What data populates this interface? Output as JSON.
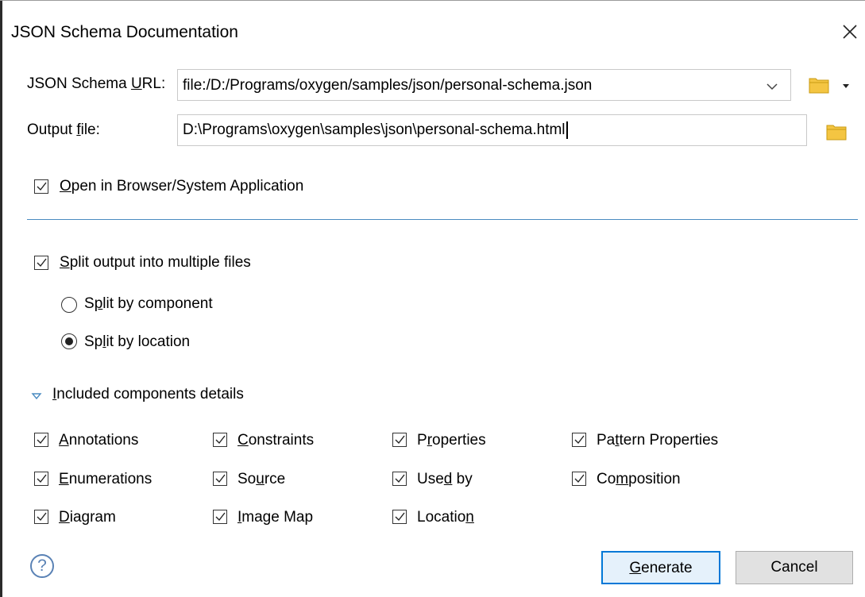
{
  "dialog": {
    "title": "JSON Schema Documentation"
  },
  "schema_url": {
    "label_pre": "JSON Schema ",
    "label_mn": "U",
    "label_post": "RL:",
    "value": "file:/D:/Programs/oxygen/samples/json/personal-schema.json"
  },
  "output_file": {
    "label_pre": "Output ",
    "label_mn": "f",
    "label_post": "ile:",
    "value": "D:\\Programs\\oxygen\\samples\\json\\personal-schema.html"
  },
  "open_browser": {
    "mn": "O",
    "rest": "pen in Browser/System Application",
    "checked": true
  },
  "split_output": {
    "mn": "S",
    "rest": "plit output into multiple files",
    "checked": true
  },
  "split_component": {
    "pre": "S",
    "mn": "p",
    "post": "lit by component",
    "selected": false
  },
  "split_location": {
    "pre": "Sp",
    "mn": "l",
    "post": "it by location",
    "selected": true
  },
  "included": {
    "mn": "I",
    "rest": "ncluded components details",
    "expanded": true
  },
  "components": {
    "annotations": {
      "pre": "",
      "mn": "A",
      "post": "nnotations",
      "checked": true
    },
    "constraints": {
      "pre": "",
      "mn": "C",
      "post": "onstraints",
      "checked": true
    },
    "properties": {
      "pre": "P",
      "mn": "r",
      "post": "operties",
      "checked": true
    },
    "pattern_properties": {
      "pre": "Pa",
      "mn": "t",
      "post": "tern Properties",
      "checked": true
    },
    "enumerations": {
      "pre": "",
      "mn": "E",
      "post": "numerations",
      "checked": true
    },
    "source": {
      "pre": "So",
      "mn": "u",
      "post": "rce",
      "checked": true
    },
    "used_by": {
      "pre": "Use",
      "mn": "d",
      "post": " by",
      "checked": true
    },
    "composition": {
      "pre": "Co",
      "mn": "m",
      "post": "position",
      "checked": true
    },
    "diagram": {
      "pre": "",
      "mn": "D",
      "post": "iagram",
      "checked": true
    },
    "image_map": {
      "pre": "",
      "mn": "I",
      "post": "mage Map",
      "checked": true
    },
    "location": {
      "pre": "Locatio",
      "mn": "n",
      "post": "",
      "checked": true
    }
  },
  "buttons": {
    "generate": {
      "mn": "G",
      "rest": "enerate"
    },
    "cancel": "Cancel"
  },
  "help": "?",
  "icons": {
    "close": "close-icon",
    "folder": "folder-icon",
    "dropdown": "chevron-down-icon",
    "help": "help-icon"
  },
  "colors": {
    "accent": "#0078d7",
    "separator": "#4a8bc1",
    "folder": "#f4c542",
    "help": "#5a82b5"
  }
}
